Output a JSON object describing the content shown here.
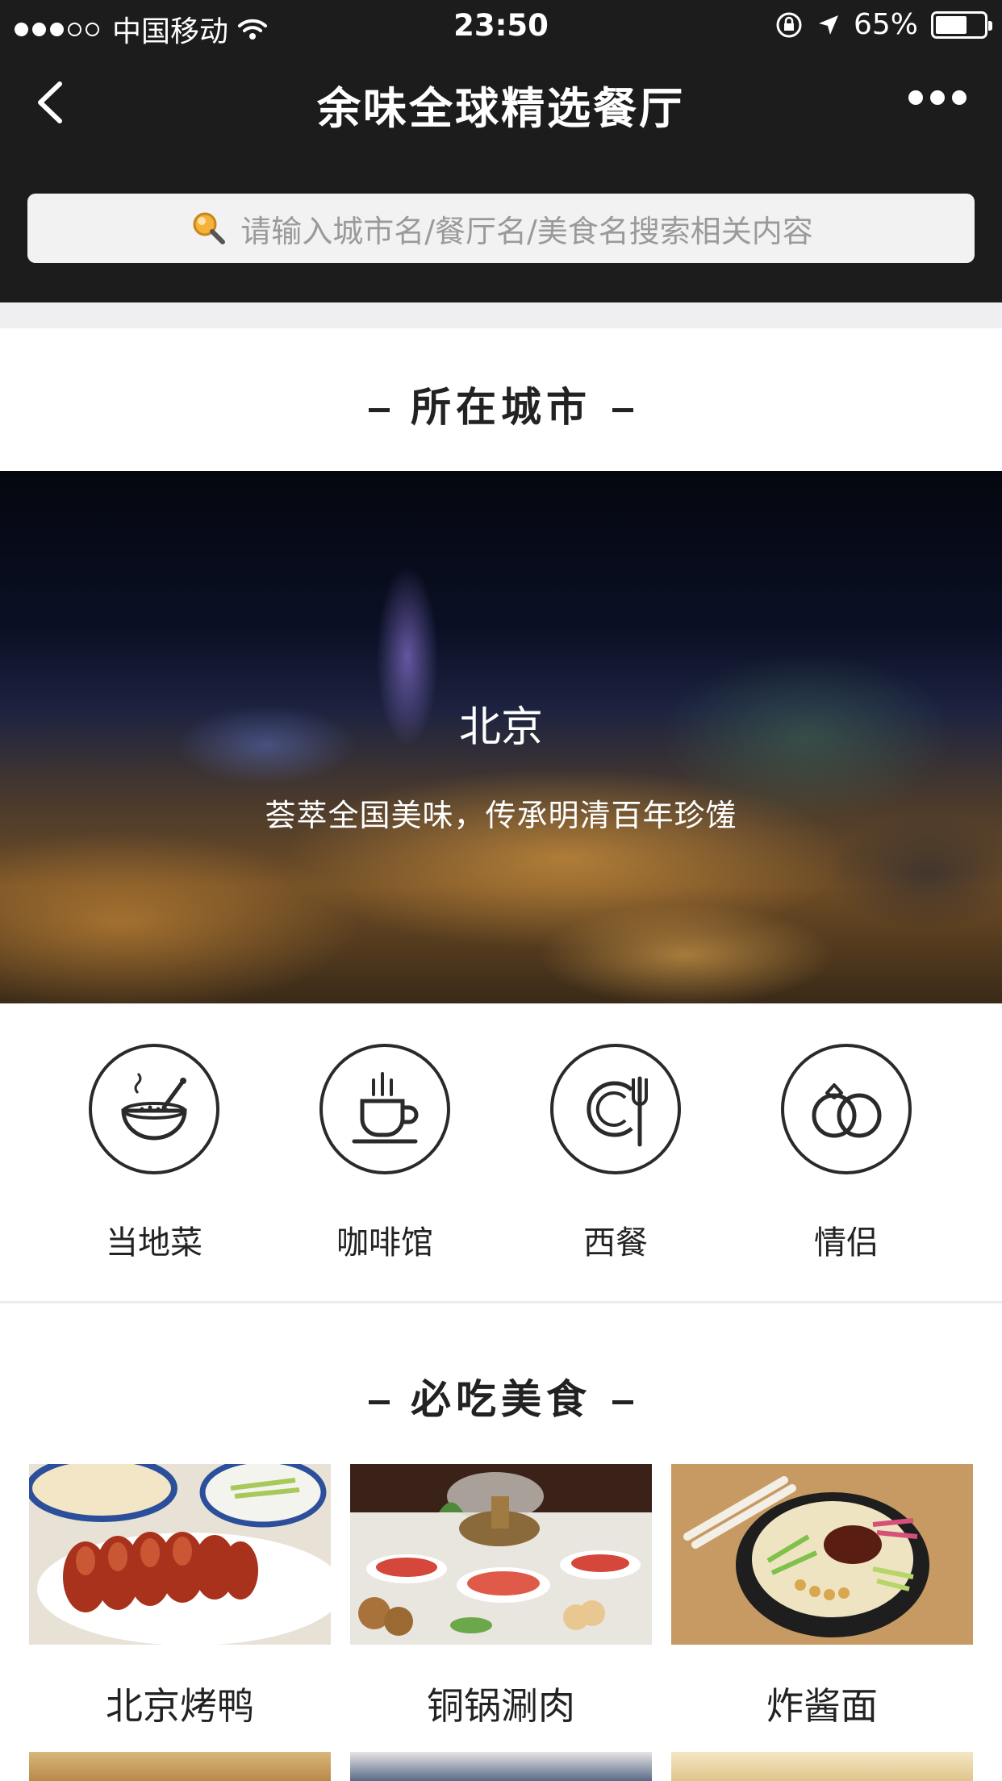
{
  "status_bar": {
    "carrier": "中国移动",
    "time": "23:50",
    "battery": "65%",
    "signal_bars_filled": 3,
    "signal_bars_total": 5,
    "battery_level": 0.65
  },
  "nav": {
    "title": "余味全球精选餐厅"
  },
  "search": {
    "placeholder": "请输入城市名/餐厅名/美食名搜索相关内容"
  },
  "city_section": {
    "heading": "所在城市",
    "city": "北京",
    "tagline": "荟萃全国美味，传承明清百年珍馐"
  },
  "categories": [
    {
      "label": "当地菜",
      "icon": "bowl-icon"
    },
    {
      "label": "咖啡馆",
      "icon": "coffee-cup-icon"
    },
    {
      "label": "西餐",
      "icon": "plate-fork-icon"
    },
    {
      "label": "情侣",
      "icon": "rings-icon"
    }
  ],
  "food_section": {
    "heading": "必吃美食",
    "items": [
      {
        "name": "北京烤鸭",
        "image": "roast-duck-photo"
      },
      {
        "name": "铜锅涮肉",
        "image": "hotpot-photo"
      },
      {
        "name": "炸酱面",
        "image": "zhajiang-noodles-photo"
      }
    ]
  },
  "colors": {
    "nav_bg": "#1c1c1d",
    "search_bg": "#f2f2f2",
    "divider": "#efeff1"
  }
}
